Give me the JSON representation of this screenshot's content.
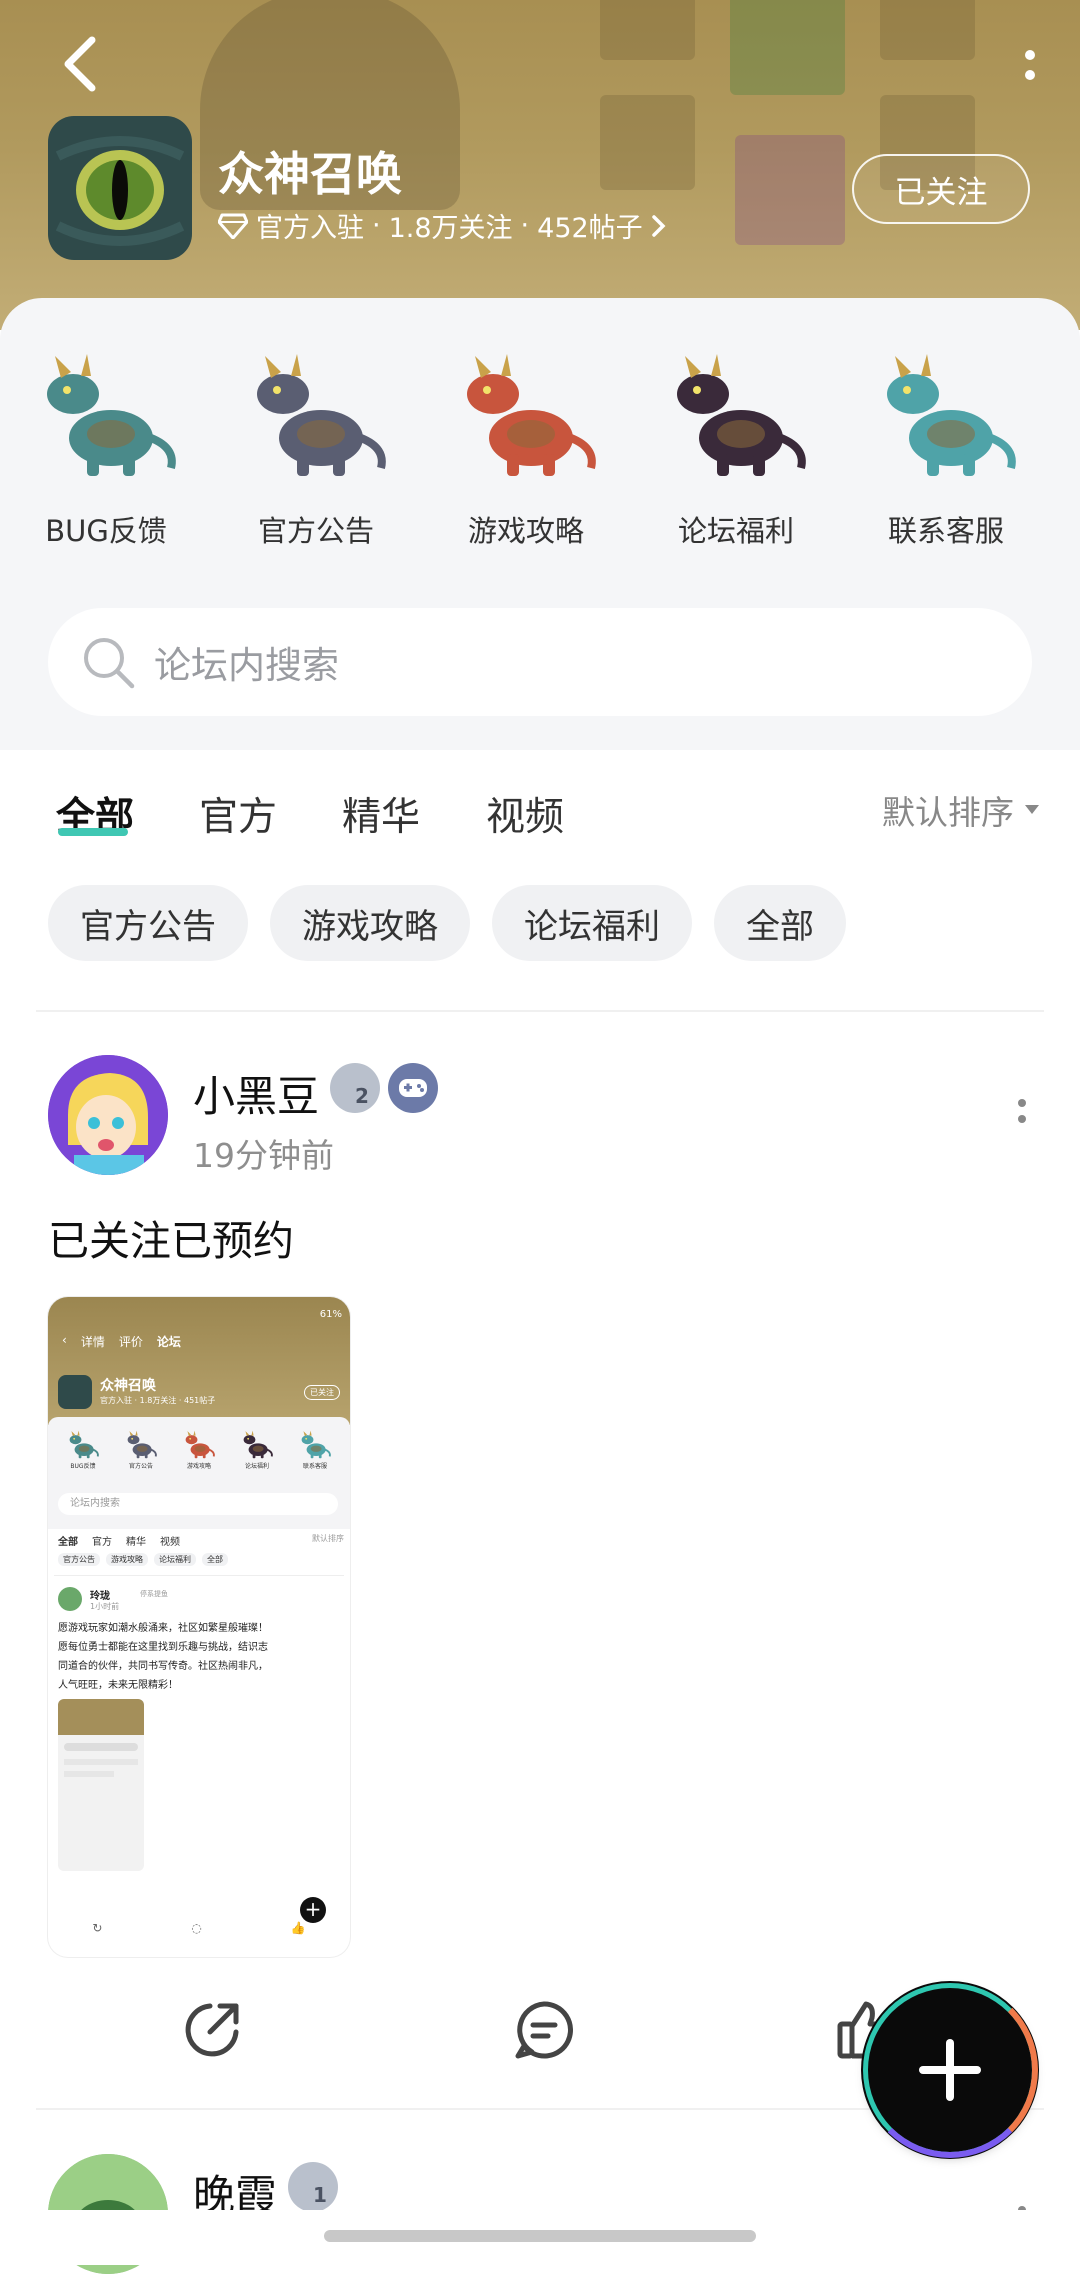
{
  "header": {
    "app_name": "众神召唤",
    "meta_badge": "官方入驻",
    "followers": "1.8万关注",
    "posts": "452帖子",
    "sep": "·",
    "follow_label": "已关注"
  },
  "categories": [
    {
      "label": "BUG反馈",
      "color": "#4a8a8a"
    },
    {
      "label": "官方公告",
      "color": "#5a5e72"
    },
    {
      "label": "游戏攻略",
      "color": "#c8553d"
    },
    {
      "label": "论坛福利",
      "color": "#3a2a3a"
    },
    {
      "label": "联系客服",
      "color": "#4fa3a8"
    }
  ],
  "search": {
    "placeholder": "论坛内搜索"
  },
  "tabs": [
    "全部",
    "官方",
    "精华",
    "视频"
  ],
  "active_tab": "全部",
  "sort_label": "默认排序",
  "chips": [
    "官方公告",
    "游戏攻略",
    "论坛福利",
    "全部"
  ],
  "post": {
    "username": "小黑豆",
    "badge_level": "2",
    "time": "19分钟前",
    "text": "已关注已预约"
  },
  "post2": {
    "username": "晚霞",
    "badge_level": "1"
  },
  "thumb": {
    "tabs": [
      "详情",
      "评价",
      "论坛"
    ],
    "app_name": "众神召唤",
    "meta": "官方入驻 · 1.8万关注 · 451帖子",
    "follow": "已关注",
    "search": "论坛内搜索",
    "tabs2": [
      "全部",
      "官方",
      "精华",
      "视频"
    ],
    "sort": "默认排序",
    "chips": [
      "官方公告",
      "游戏攻略",
      "论坛福利",
      "全部"
    ],
    "cat_labels": [
      "BUG反馈",
      "官方公告",
      "游戏攻略",
      "论坛福利",
      "联系客服"
    ],
    "post_user": "玲珑",
    "post_tag": "停系提鱼",
    "post_time": "1小时前",
    "post_lines": [
      "愿游戏玩家如潮水般涌来，社区如繁星般璀璨！",
      "愿每位勇士都能在这里找到乐趣与挑战，结识志",
      "同道合的伙伴，共同书写传奇。社区热闹非凡，",
      "人气旺旺，未来无限精彩！"
    ],
    "battery": "61%"
  },
  "colors": {
    "accent": "#3fc7b3",
    "header": "#b19a5e"
  }
}
